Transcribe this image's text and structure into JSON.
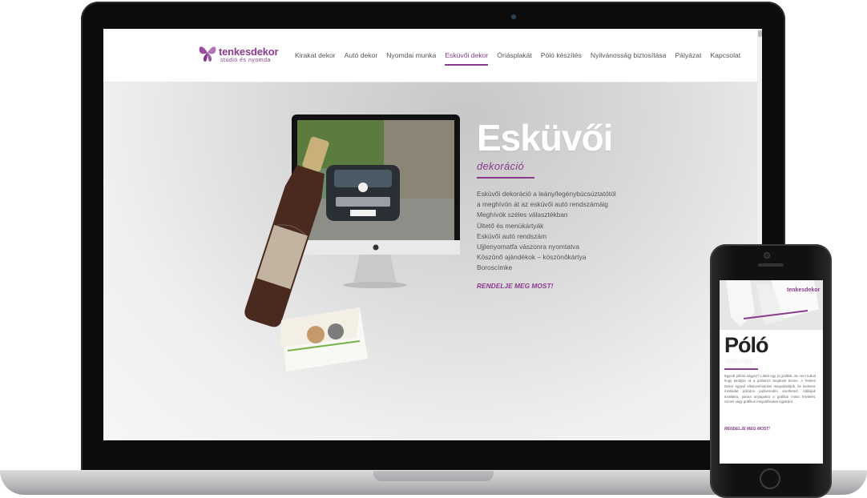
{
  "site": {
    "logo_name": "tenkesdekor",
    "logo_tagline": "stúdió és nyomda"
  },
  "nav": {
    "items": [
      {
        "label": "Kirakat dekor",
        "active": false
      },
      {
        "label": "Autó dekor",
        "active": false
      },
      {
        "label": "Nyomdai munka",
        "active": false
      },
      {
        "label": "Esküvői dekor",
        "active": true
      },
      {
        "label": "Óriásplakát",
        "active": false
      },
      {
        "label": "Póló készítés",
        "active": false
      },
      {
        "label": "Nyilvánosság biztosítása",
        "active": false
      },
      {
        "label": "Pályázat",
        "active": false
      },
      {
        "label": "Kapcsolat",
        "active": false
      }
    ]
  },
  "hero": {
    "title": "Esküvői",
    "subtitle": "dekoráció",
    "items": [
      "Esküvői dekoráció a leány/legénybúcsúztatótól",
      "a meghívón át az esküvői autó rendszámáig",
      "Meghívók széles választékban",
      "Ültető és menükártyák",
      "Esküvői autó rendszám",
      "Ujjlenyomatfa vászonra nyomtatva",
      "Köszönő ajándékok – köszönőkártya",
      "Boroscímke"
    ],
    "cta": "RENDELJE MEG MOST!"
  },
  "phone": {
    "title": "Póló",
    "subtitle": "készítés",
    "body": "Egyedi pólóra vágysz? Láttál egy jó grafikát, de nem tudod hogy kerüljön rá a pólódra? Segítünk benne. A Tenkes Dekor egyedi elképzelésünket megvalósítjuk, és kedvenc mintáidat pólódon pulóveredén viselheted. Vállaljuk textilakra, pamut anyagokra a grafikai minta felvitelét, színes vagy grafikus megoldásokat egyaránt.",
    "cta": "RENDELJE MEG MOST!"
  },
  "colors": {
    "brand": "#8a3c8c",
    "text": "#555555",
    "hero_title": "#ffffff"
  }
}
